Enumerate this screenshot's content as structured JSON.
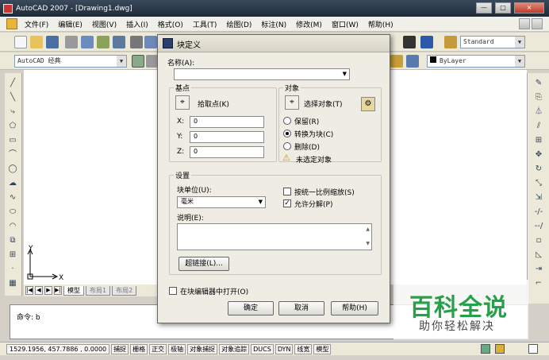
{
  "window": {
    "title": "AutoCAD 2007 - [Drawing1.dwg]",
    "min": "—",
    "max": "□",
    "close": "×"
  },
  "menu": [
    "文件(F)",
    "编辑(E)",
    "视图(V)",
    "插入(I)",
    "格式(O)",
    "工具(T)",
    "绘图(D)",
    "标注(N)",
    "修改(M)",
    "窗口(W)",
    "帮助(H)"
  ],
  "toolbar": {
    "text_style": "Standard",
    "workspace": "AutoCAD 经典",
    "layer": "ByLayer"
  },
  "layout_tabs": {
    "model": "模型",
    "layout1": "布局1",
    "layout2": "布局2"
  },
  "command_line": {
    "prompt": "命令: b"
  },
  "ucs": {
    "x": "X",
    "y": "Y"
  },
  "status": {
    "coords": "1529.1956, 457.7886 , 0.0000",
    "buttons": [
      "捕捉",
      "栅格",
      "正交",
      "极轴",
      "对象捕捉",
      "对象追踪",
      "DUCS",
      "DYN",
      "线宽",
      "模型"
    ]
  },
  "dialog": {
    "title": "块定义",
    "name_label": "名称(A):",
    "name_value": "",
    "base": {
      "group": "基点",
      "pick_label": "拾取点(K)",
      "x_label": "X:",
      "x_value": "0",
      "y_label": "Y:",
      "y_value": "0",
      "z_label": "Z:",
      "z_value": "0"
    },
    "objects": {
      "group": "对象",
      "select_label": "选择对象(T)",
      "retain": "保留(R)",
      "convert": "转换为块(C)",
      "delete": "删除(D)",
      "warning": "未选定对象",
      "selected_mode": "convert"
    },
    "settings": {
      "group": "设置",
      "unit_label": "块单位(U):",
      "unit_value": "毫米",
      "scale_uniform": "按统一比例缩放(S)",
      "scale_uniform_checked": false,
      "allow_explode": "允许分解(P)",
      "allow_explode_checked": true,
      "desc_label": "说明(E):",
      "hyperlink": "超链接(L)..."
    },
    "open_in_editor": "在块编辑器中打开(O)",
    "open_in_editor_checked": false,
    "ok": "确定",
    "cancel": "取消",
    "help": "帮助(H)"
  },
  "watermark": {
    "title": "百科全说",
    "subtitle": "助你轻松解决"
  }
}
